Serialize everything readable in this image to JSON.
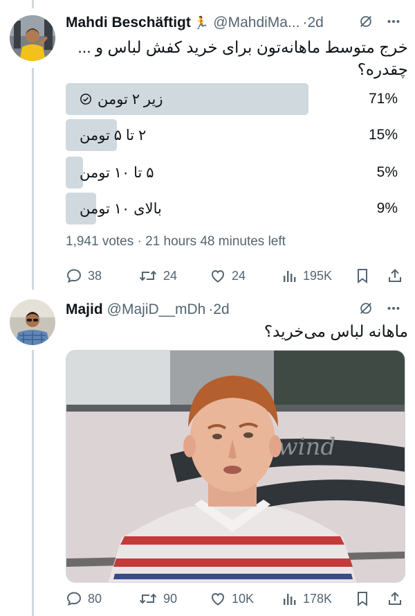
{
  "tweet1": {
    "display_name": "Mahdi Beschäftigt",
    "name_emoji": "🏃",
    "handle": "@MahdiMa...",
    "separator": "·",
    "time": "2d",
    "text_line1": "خرج متوسط ماهانه‌تون برای خرید کفش لباس و ...",
    "text_line2": "چقدره؟",
    "poll": {
      "options": [
        {
          "label": "زیر ۲ تومن",
          "percent_text": "71%",
          "percent": 71,
          "selected": true
        },
        {
          "label": "۲ تا ۵ تومن",
          "percent_text": "15%",
          "percent": 15,
          "selected": false
        },
        {
          "label": "۵ تا ۱۰ تومن",
          "percent_text": "5%",
          "percent": 5,
          "selected": false
        },
        {
          "label": "بالای ۱۰ تومن",
          "percent_text": "9%",
          "percent": 9,
          "selected": false
        }
      ],
      "votes": "1,941 votes",
      "dot": "·",
      "time_left": "21 hours 48 minutes left"
    },
    "actions": {
      "replies": "38",
      "retweets": "24",
      "likes": "24",
      "views": "195K"
    }
  },
  "tweet2": {
    "display_name": "Majid",
    "handle": "@MajiD__mDh",
    "separator": "·",
    "time": "2d",
    "text": "ماهانه لباس می‌خرید؟",
    "actions": {
      "replies": "80",
      "retweets": "90",
      "likes": "10K",
      "views": "178K"
    }
  },
  "colors": {
    "text": "#0f1419",
    "muted": "#536471",
    "poll_bar": "#cfd9de",
    "thread_line": "#cfd9de"
  },
  "icons": [
    "grok-slash-icon",
    "more-icon",
    "reply-icon",
    "retweet-icon",
    "like-icon",
    "views-icon",
    "bookmark-icon",
    "share-icon",
    "check-circle-icon"
  ]
}
